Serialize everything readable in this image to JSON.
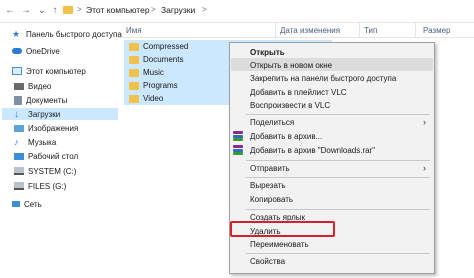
{
  "address": {
    "crumbs": [
      "Этот компьютер",
      "Загрузки"
    ],
    "separator": ">"
  },
  "nav_pane": {
    "quick_access": "Панель быстрого доступа",
    "onedrive": "OneDrive",
    "this_pc": "Этот компьютер",
    "items": [
      "Видео",
      "Документы",
      "Загрузки",
      "Изображения",
      "Музыка",
      "Рабочий стол",
      "SYSTEM (C:)",
      "FILES (G:)"
    ],
    "network": "Сеть"
  },
  "columns": [
    "Имя",
    "Дата изменения",
    "Тип",
    "Размер"
  ],
  "files": [
    "Compressed",
    "Documents",
    "Music",
    "Programs",
    "Video"
  ],
  "context_menu": {
    "open": "Открыть",
    "open_new_window": "Открыть в новом окне",
    "pin_quick_access": "Закрепить на панели быстрого доступа",
    "add_vlc_playlist": "Добавить в плейлист VLC",
    "play_vlc": "Воспроизвести в VLC",
    "share": "Поделиться",
    "add_archive": "Добавить в архив...",
    "add_archive_named": "Добавить в архив \"Downloads.rar\"",
    "send_to": "Отправить",
    "cut": "Вырезать",
    "copy": "Копировать",
    "create_shortcut": "Создать ярлык",
    "delete": "Удалить",
    "rename": "Переименовать",
    "properties": "Свойства"
  },
  "colors": {
    "selection": "#cce8ff",
    "highlight_box": "#d9202a",
    "folder": "#f0c24b"
  }
}
